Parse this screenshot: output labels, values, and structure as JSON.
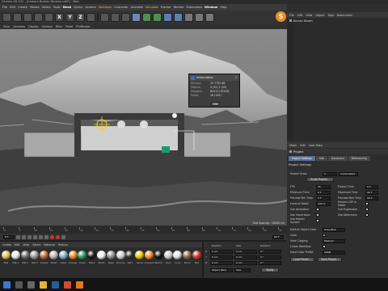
{
  "window": {
    "title": "Cinema 4D S22 - [Camera Bureau Dinamo.c4d*] - Main"
  },
  "menubar": [
    {
      "label": "File"
    },
    {
      "label": "Edit"
    },
    {
      "label": "Create"
    },
    {
      "label": "Modes"
    },
    {
      "label": "Select"
    },
    {
      "label": "Tools"
    },
    {
      "label": "Mesh"
    },
    {
      "label": "Spline"
    },
    {
      "label": "Volume"
    },
    {
      "label": "MoGraph"
    },
    {
      "label": "Character"
    },
    {
      "label": "Animate"
    },
    {
      "label": "Simulate"
    },
    {
      "label": "Tracker"
    },
    {
      "label": "Render"
    },
    {
      "label": "Extensions"
    },
    {
      "label": "Window"
    },
    {
      "label": "Help"
    }
  ],
  "toolbar": {
    "xyz_labels": [
      "X",
      "Y",
      "Z"
    ],
    "logo_letter": "S"
  },
  "viewport": {
    "menu": [
      "View",
      "Cameras",
      "Display",
      "Options",
      "Filter",
      "Panel",
      "ProRender"
    ],
    "grid_spacing": "Grid Spacing : 10000 cm"
  },
  "info_dialog": {
    "title": "Information",
    "rows": [
      {
        "k": "Memory",
        "v": "25 7792 KB"
      },
      {
        "k": "Objects",
        "v": "4 (20) 1 (50)"
      },
      {
        "k": "Polygons",
        "v": "82012 (78106)"
      },
      {
        "k": "Points",
        "v": "16 (195)"
      }
    ],
    "ok_label": "OK"
  },
  "object_manager": {
    "menu": [
      "File",
      "Edit",
      "View",
      "Object",
      "Tags",
      "Bookmarks"
    ],
    "items": [
      {
        "label": "Bureau Dinam"
      }
    ]
  },
  "attribute_manager": {
    "menu": [
      "Mode",
      "Edit",
      "User Data"
    ],
    "header": "Project",
    "tabs": [
      {
        "label": "Project Settings",
        "active": true
      },
      {
        "label": "Info",
        "active": false
      },
      {
        "label": "Dynamics",
        "active": false
      },
      {
        "label": "Referencing",
        "active": false
      }
    ],
    "section_title": "Project Settings",
    "rows_left": [
      {
        "label": "Project Scale",
        "value": "1"
      },
      {
        "label": "FPS",
        "value": "25"
      },
      {
        "label": "Minimum Time",
        "value": "0 F"
      },
      {
        "label": "Preview Min Time",
        "value": "0 F"
      },
      {
        "label": "Level of Detail",
        "value": "100 %"
      },
      {
        "label": "Use Animation",
        "value": ""
      },
      {
        "label": "Use Generators",
        "value": ""
      },
      {
        "label": "Use Motion System",
        "value": ""
      }
    ],
    "rows_right": [
      {
        "label": "Project Time",
        "value": "0 F"
      },
      {
        "label": "Maximum Time",
        "value": "90 F"
      },
      {
        "label": "Preview Max Time",
        "value": "90 F"
      },
      {
        "label": "Render LOD in Editor",
        "value": ""
      },
      {
        "label": "Use Expression",
        "value": ""
      },
      {
        "label": "Use Deformers",
        "value": ""
      }
    ],
    "scale_unit": "Centimeters",
    "scale_button": "Scale Project...",
    "lower_rows": [
      {
        "label": "Default Object Color",
        "value": "Gray-Blue"
      },
      {
        "label": "Color",
        "value": ""
      },
      {
        "label": "View Clipping",
        "value": "Medium"
      },
      {
        "label": "Linear Workflow",
        "value": ""
      },
      {
        "label": "Input Color Profile",
        "value": "sRGB"
      }
    ],
    "buttons": [
      "Load Preset...",
      "Save Preset..."
    ]
  },
  "timeline": {
    "ticks": [
      "0",
      "5",
      "10",
      "15",
      "20",
      "25",
      "30",
      "35",
      "40",
      "45",
      "50",
      "55",
      "60",
      "65",
      "70",
      "75",
      "80",
      "85",
      "90"
    ],
    "current": "0 F",
    "end": "90 F"
  },
  "material_manager": {
    "menu": [
      "Create",
      "Edit",
      "View",
      "Select",
      "Material",
      "Texture"
    ],
    "materials": [
      {
        "label": "Mat",
        "color": "#d4c25a"
      },
      {
        "label": "Mat.1",
        "color": "#e6e6e6"
      },
      {
        "label": "Mat.2",
        "color": "#6c6c6c"
      },
      {
        "label": "Mat.3",
        "color": "#9a9a9a"
      },
      {
        "label": "Copper",
        "color": "#b66a3a"
      },
      {
        "label": "Metal",
        "color": "#b8b8b8"
      },
      {
        "label": "Glass",
        "color": "#7fb0c8"
      },
      {
        "label": "Orange",
        "color": "#e88a2a"
      },
      {
        "label": "Green",
        "color": "#2f9e6a"
      },
      {
        "label": "Black",
        "color": "#1a1a1a"
      },
      {
        "label": "White",
        "color": "#f0f0f0"
      },
      {
        "label": "Steel",
        "color": "#8c8c8c"
      },
      {
        "label": "Chrome",
        "color": "#cfcfcf"
      },
      {
        "label": "Dark",
        "color": "#303030"
      },
      {
        "label": "Yellow",
        "color": "#f2c200"
      },
      {
        "label": "Orange2",
        "color": "#f08a24"
      },
      {
        "label": "Black2",
        "color": "#121212"
      },
      {
        "label": "Gray",
        "color": "#c8c8c8"
      },
      {
        "label": "Cone",
        "color": "#e0e0e0"
      },
      {
        "label": "Wood",
        "color": "#8a6a44"
      },
      {
        "label": "Red",
        "color": "#d03a2a"
      }
    ]
  },
  "coordinates": {
    "headers": [
      "Position",
      "Size",
      "Rotation"
    ],
    "rows": [
      {
        "axis": "X",
        "pos": "0 cm",
        "size": "0 cm",
        "rot": "0 °"
      },
      {
        "axis": "Y",
        "pos": "0 cm",
        "size": "0 cm",
        "rot": "0 °"
      },
      {
        "axis": "Z",
        "pos": "0 cm",
        "size": "0 cm",
        "rot": "0 °"
      }
    ],
    "mode": "Object (Rel)",
    "size_mode": "Size",
    "apply": "Apply"
  },
  "taskbar": {
    "apps": [
      {
        "name": "windows-start",
        "color": "#3a78d0"
      },
      {
        "name": "search",
        "color": "#555555"
      },
      {
        "name": "task-view",
        "color": "#666666"
      },
      {
        "name": "explorer",
        "color": "#e7b43a"
      },
      {
        "name": "cinema4d",
        "color": "#1f5fa0"
      },
      {
        "name": "chrome",
        "color": "#d04a37"
      },
      {
        "name": "firefox",
        "color": "#e8751a"
      }
    ]
  },
  "colors": {
    "accent": "#f08a24",
    "menu_highlight": "#f2b46b",
    "active_tab": "#5a6f95"
  }
}
